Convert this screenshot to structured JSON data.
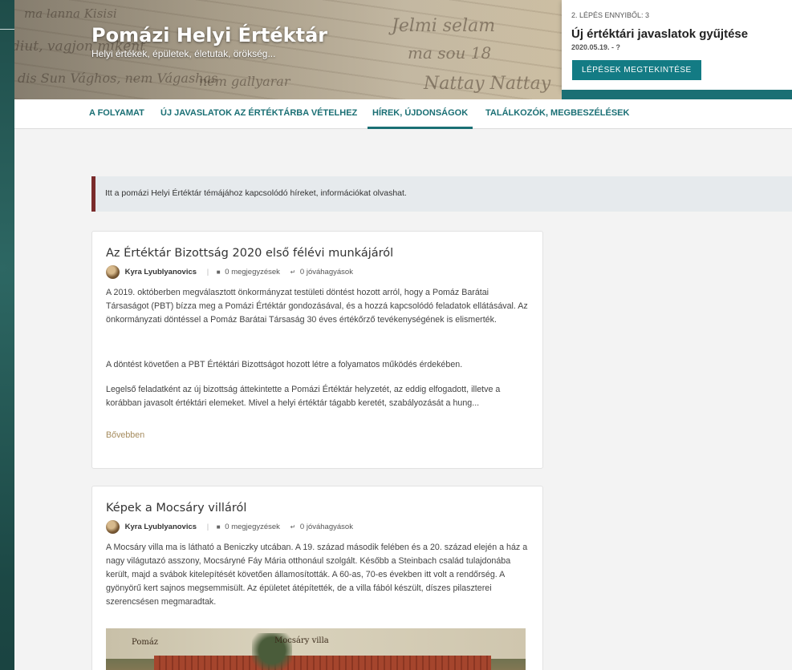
{
  "brand": {
    "title": "Pomázi Helyi Értéktár",
    "subtitle": "Helyi értékek, épületek, életutak, örökség..."
  },
  "step_panel": {
    "count_label": "2. LÉPÉS ENNYIBŐL: 3",
    "title": "Új értéktári javaslatok gyűjtése",
    "date": "2020.05.19. - ?",
    "button_label": "LÉPÉSEK MEGTEKINTÉSE"
  },
  "nav": {
    "items": [
      {
        "label": "A FOLYAMAT"
      },
      {
        "label": "ÚJ JAVASLATOK AZ ÉRTÉKTÁRBA VÉTELHEZ"
      },
      {
        "label": "HÍREK, ÚJDONSÁGOK"
      },
      {
        "label": "TALÁLKOZÓK, MEGBESZÉLÉSEK"
      }
    ],
    "active": "HÍREK, ÚJDONSÁGOK"
  },
  "info_bar": {
    "text": "Itt a pomázi Helyi Értéktár témájához kapcsolódó híreket, információkat olvashat."
  },
  "posts": [
    {
      "title": "Az Értéktár Bizottság 2020 első félévi munkájáról",
      "author": "Kyra Lyublyanovics",
      "comments": "0 megjegyzések",
      "endorsements": "0 jóváhagyások",
      "paragraphs": [
        "A 2019. októberben megválasztott önkormányzat testületi döntést hozott arról, hogy a Pomáz Barátai Társaságot (PBT) bízza meg a Pomázi Értéktár gondozásával, és a hozzá kapcsolódó feladatok ellátásával. Az önkormányzati döntéssel a Pomáz Barátai Társaság 30 éves értékőrző tevékenységének is elismerték.",
        "A döntést követően a PBT Értéktári Bizottságot hozott létre a folyamatos működés érdekében.",
        "Legelső feladatként az új bizottság áttekintette a Pomázi Értéktár helyzetét, az eddig elfogadott, illetve a korábban javasolt értéktári elemeket. Mivel a helyi értéktár tágabb keretét, szabályozását a hung..."
      ],
      "more_label": "Bővebben"
    },
    {
      "title": "Képek a Mocsáry villáról",
      "author": "Kyra Lyublyanovics",
      "comments": "0 megjegyzések",
      "endorsements": "0 jóváhagyások",
      "paragraphs": [
        "A Mocsáry villa ma is látható a Beniczky utcában. A 19. század második felében és a 20. század elején a ház a nagy világutazó asszony, Mocsáryné Fáy Mária otthonául szolgált. Később a Steinbach család tulajdonába került, majd a svábok kitelepítését követően államosították. A 60-as, 70-es években itt volt a rendőrség. A gyönyörű kert sajnos megsemmisült. Az épületet átépítették, de a villa fából készült, díszes pilaszterei szerencsésen megmaradtak."
      ],
      "image_captions": [
        "Pomáz",
        "Mocsáry villa"
      ]
    }
  ],
  "colors": {
    "accent": "#1a6f74",
    "button": "#137b84",
    "info_border": "#7a2b2b",
    "more_link": "#a58b5d"
  }
}
